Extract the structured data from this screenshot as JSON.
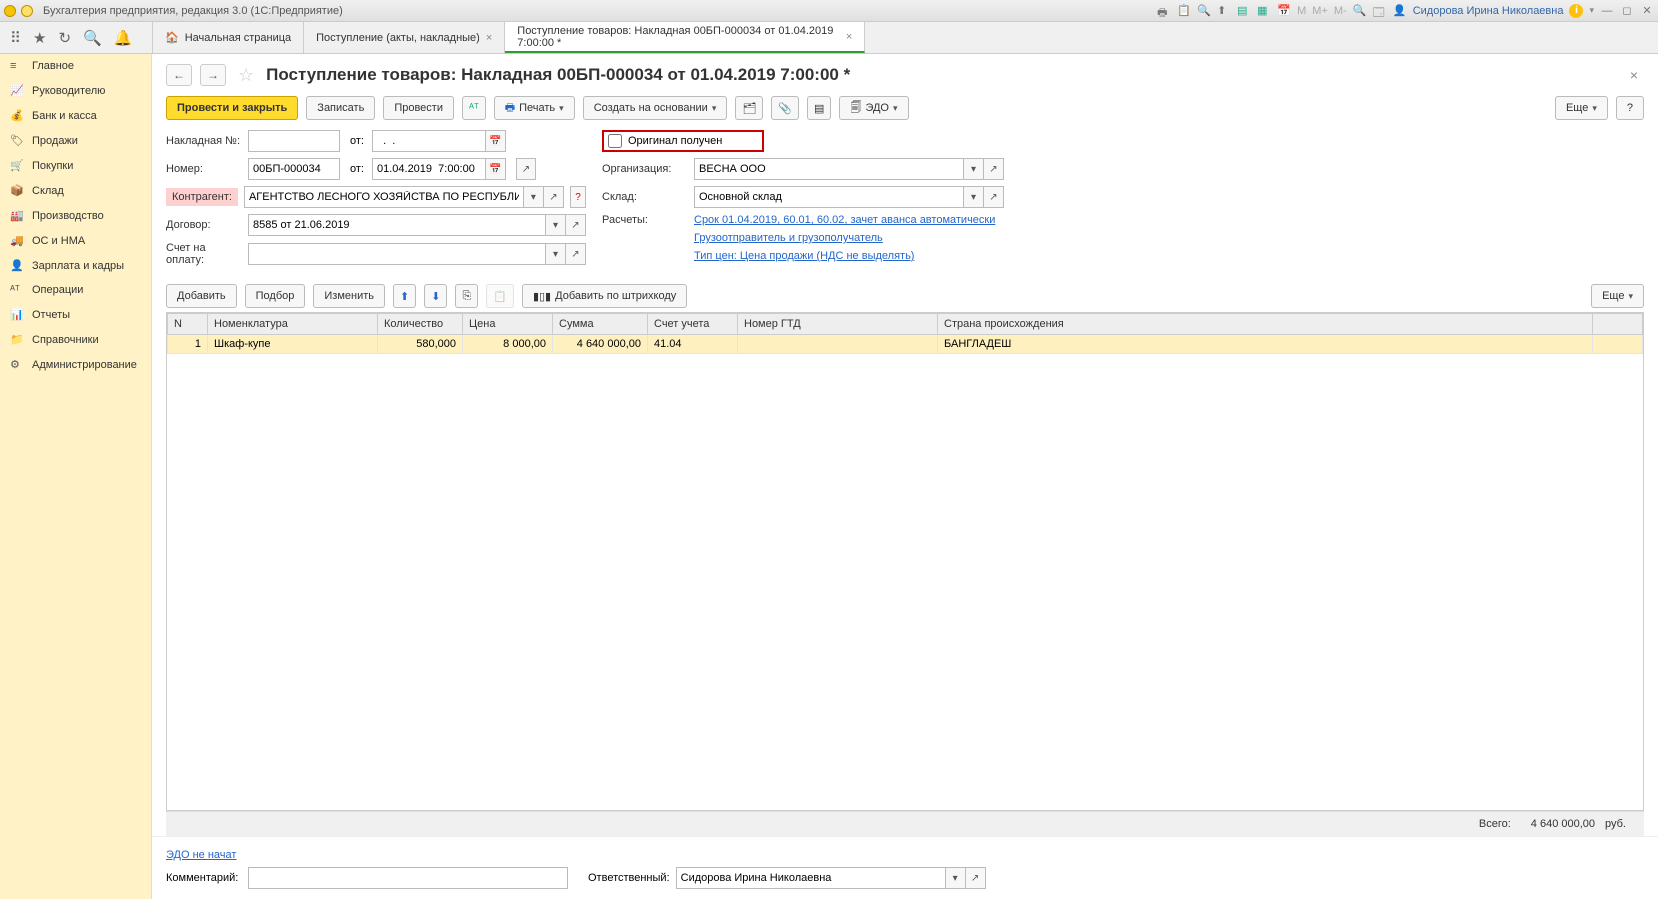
{
  "titlebar": {
    "app_title": "Бухгалтерия предприятия, редакция 3.0  (1С:Предприятие)",
    "user": "Сидорова Ирина Николаевна",
    "m_labels": [
      "M",
      "M+",
      "M-"
    ]
  },
  "toolbar_tabs": {
    "home": "Начальная страница",
    "tab1": "Поступление (акты, накладные)",
    "tab2": "Поступление товаров: Накладная 00БП-000034 от 01.04.2019 7:00:00 *"
  },
  "sidebar": {
    "items": [
      {
        "label": "Главное"
      },
      {
        "label": "Руководителю"
      },
      {
        "label": "Банк и касса"
      },
      {
        "label": "Продажи"
      },
      {
        "label": "Покупки"
      },
      {
        "label": "Склад"
      },
      {
        "label": "Производство"
      },
      {
        "label": "ОС и НМА"
      },
      {
        "label": "Зарплата и кадры"
      },
      {
        "label": "Операции"
      },
      {
        "label": "Отчеты"
      },
      {
        "label": "Справочники"
      },
      {
        "label": "Администрирование"
      }
    ]
  },
  "doc": {
    "title": "Поступление товаров: Накладная 00БП-000034 от 01.04.2019 7:00:00 *"
  },
  "cmd": {
    "post_close": "Провести и закрыть",
    "save": "Записать",
    "post": "Провести",
    "print": "Печать",
    "create_based": "Создать на основании",
    "edo": "ЭДО",
    "more": "Еще",
    "help": "?"
  },
  "form": {
    "invoice_lbl": "Накладная №:",
    "invoice_no": "",
    "from_lbl": "от:",
    "invoice_date": "  .  .    ",
    "original_received": "Оригинал получен",
    "number_lbl": "Номер:",
    "number": "00БП-000034",
    "number_date": "01.04.2019  7:00:00",
    "org_lbl": "Организация:",
    "org": "ВЕСНА ООО",
    "kontragent_lbl": "Контрагент:",
    "kontragent": "АГЕНТСТВО ЛЕСНОГО ХОЗЯЙСТВА ПО РЕСПУБЛИКЕ МС",
    "sklad_lbl": "Склад:",
    "sklad": "Основной склад",
    "dogovor_lbl": "Договор:",
    "dogovor": "8585 от 21.06.2019",
    "rascety_lbl": "Расчеты:",
    "rascety_link": "Срок 01.04.2019, 60.01, 60.02, зачет аванса автоматически",
    "schet_lbl": "Счет на оплату:",
    "schet": "",
    "gruzo_link": "Грузоотправитель и грузополучатель",
    "price_type_link": "Тип цен: Цена продажи (НДС не выделять)"
  },
  "table_cmd": {
    "add": "Добавить",
    "pick": "Подбор",
    "edit": "Изменить",
    "barcode": "Добавить по штрихкоду",
    "more": "Еще"
  },
  "table": {
    "cols": [
      "N",
      "Номенклатура",
      "Количество",
      "Цена",
      "Сумма",
      "Счет учета",
      "Номер ГТД",
      "Страна происхождения"
    ],
    "rows": [
      {
        "n": "1",
        "nom": "Шкаф-купе",
        "qty": "580,000",
        "price": "8 000,00",
        "sum": "4 640 000,00",
        "account": "41.04",
        "gtd": "",
        "country": "БАНГЛАДЕШ"
      }
    ]
  },
  "totals": {
    "label": "Всего:",
    "value": "4 640 000,00",
    "currency": "руб."
  },
  "footer": {
    "edo_link": "ЭДО не начат",
    "comment_lbl": "Комментарий:",
    "comment": "",
    "responsible_lbl": "Ответственный:",
    "responsible": "Сидорова Ирина Николаевна"
  }
}
